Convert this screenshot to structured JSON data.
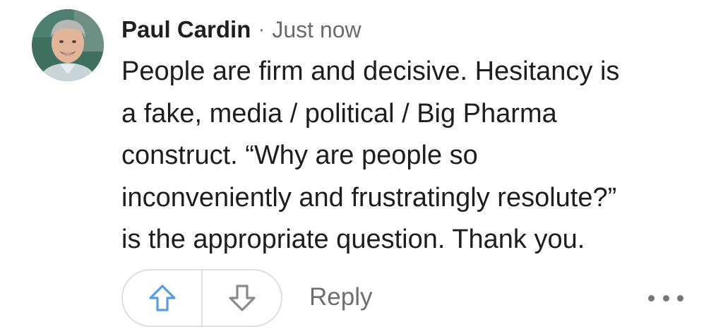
{
  "comment": {
    "author": "Paul Cardin",
    "separator": "·",
    "timestamp": "Just now",
    "body_lines": [
      "People are firm and decisive. Hesitancy is",
      "a fake, media / political / Big Pharma",
      "construct. “Why are people so",
      "inconveniently and frustratingly resolute?”",
      "is the appropriate question. Thank you."
    ]
  },
  "actions": {
    "upvote_icon": "arrow-up-outline-icon",
    "downvote_icon": "arrow-down-outline-icon",
    "reply_label": "Reply",
    "more_icon": "more-horizontal-icon"
  },
  "colors": {
    "upvote": "#5a9be6",
    "downvote": "#8a8a8a",
    "muted_text": "#6e6e6e",
    "pill_border": "#dedede"
  }
}
